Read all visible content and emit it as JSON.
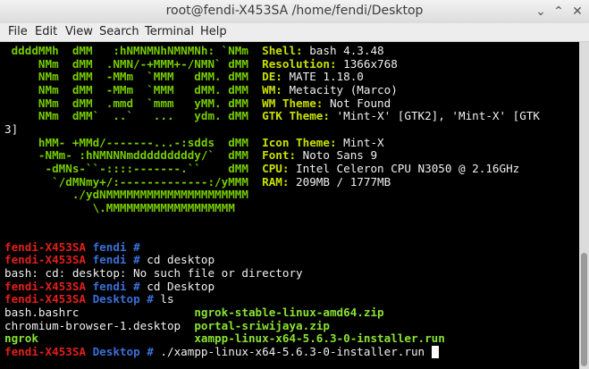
{
  "window": {
    "title": "root@fendi-X453SA /home/fendi/Desktop",
    "minimize_glyph": "⌄",
    "maximize_glyph": "⌃",
    "close_glyph": "✕"
  },
  "menu": [
    "File",
    "Edit",
    "View",
    "Search",
    "Terminal",
    "Help"
  ],
  "colors": {
    "ascii_green": "#77cc00",
    "info_key": "#c8e000",
    "text": "#f0f0f0",
    "prompt_red": "#e0201a",
    "prompt_blue": "#3a6fd8",
    "exec_green": "#8ae234"
  },
  "terminal": {
    "lines": [
      [
        {
          "t": " ddddMMh  dMM   :hNMNMNhNMNMNh: `NMm  ",
          "c": "ascii_green"
        },
        {
          "t": "Shell:",
          "c": "info_key"
        },
        {
          "t": " bash 4.3.48",
          "c": "text"
        }
      ],
      [
        {
          "t": "     NMm  dMM  .NMN/-+MMM+-/NMN` dMM  ",
          "c": "ascii_green"
        },
        {
          "t": "Resolution:",
          "c": "info_key"
        },
        {
          "t": " 1366x768",
          "c": "text"
        }
      ],
      [
        {
          "t": "     NMm  dMM  -MMm  `MMM   dMM. dMM  ",
          "c": "ascii_green"
        },
        {
          "t": "DE:",
          "c": "info_key"
        },
        {
          "t": " MATE 1.18.0",
          "c": "text"
        }
      ],
      [
        {
          "t": "     NMm  dMM  -MMm  `MMM   dMM. dMM  ",
          "c": "ascii_green"
        },
        {
          "t": "WM:",
          "c": "info_key"
        },
        {
          "t": " Metacity (Marco)",
          "c": "text"
        }
      ],
      [
        {
          "t": "     NMm  dMM  .mmd  `mmm   yMM. dMM  ",
          "c": "ascii_green"
        },
        {
          "t": "WM Theme:",
          "c": "info_key"
        },
        {
          "t": " Not Found",
          "c": "text"
        }
      ],
      [
        {
          "t": "     NMm  dMM`  ..`   ...   ydm. dMM  ",
          "c": "ascii_green"
        },
        {
          "t": "GTK Theme:",
          "c": "info_key"
        },
        {
          "t": " 'Mint-X' [GTK2], 'Mint-X' [GTK",
          "c": "text"
        }
      ],
      [
        {
          "t": "3]",
          "c": "text"
        }
      ],
      [
        {
          "t": "     hMM- +MMd/-------...-:sdds  dMM  ",
          "c": "ascii_green"
        },
        {
          "t": "Icon Theme:",
          "c": "info_key"
        },
        {
          "t": " Mint-X",
          "c": "text"
        }
      ],
      [
        {
          "t": "     -NMm- :hNMNNNmdddddddddy/`  dMM  ",
          "c": "ascii_green"
        },
        {
          "t": "Font:",
          "c": "info_key"
        },
        {
          "t": " Noto Sans 9",
          "c": "text"
        }
      ],
      [
        {
          "t": "      -dMNs-``-::::-------.``    dMM  ",
          "c": "ascii_green"
        },
        {
          "t": "CPU:",
          "c": "info_key"
        },
        {
          "t": " Intel Celeron CPU N3050 @ 2.16GHz",
          "c": "text"
        }
      ],
      [
        {
          "t": "       `/dMNmy+/:-------------:/yMMM  ",
          "c": "ascii_green"
        },
        {
          "t": "RAM:",
          "c": "info_key"
        },
        {
          "t": " 209MB / 1777MB",
          "c": "text"
        }
      ],
      [
        {
          "t": "          ./ydNMMMMMMMMMMMMMMMMMMMMM",
          "c": "ascii_green"
        }
      ],
      [
        {
          "t": "             \\.MMMMMMMMMMMMMMMMMMM",
          "c": "ascii_green"
        }
      ],
      [],
      [],
      [
        {
          "t": "fendi-X453SA",
          "c": "prompt_red"
        },
        {
          "t": " fendi #",
          "c": "prompt_blue"
        }
      ],
      [
        {
          "t": "fendi-X453SA",
          "c": "prompt_red"
        },
        {
          "t": " fendi #",
          "c": "prompt_blue"
        },
        {
          "t": " cd desktop",
          "c": "text"
        }
      ],
      [
        {
          "t": "bash: cd: desktop: No such file or directory",
          "c": "text"
        }
      ],
      [
        {
          "t": "fendi-X453SA",
          "c": "prompt_red"
        },
        {
          "t": " fendi #",
          "c": "prompt_blue"
        },
        {
          "t": " cd Desktop",
          "c": "text"
        }
      ],
      [
        {
          "t": "fendi-X453SA",
          "c": "prompt_red"
        },
        {
          "t": " Desktop #",
          "c": "prompt_blue"
        },
        {
          "t": " ls",
          "c": "text"
        }
      ],
      [
        {
          "t": "bash.bashrc                 ",
          "c": "text"
        },
        {
          "t": "ngrok-stable-linux-amd64.zip",
          "c": "exec_green"
        }
      ],
      [
        {
          "t": "chromium-browser-1.desktop  ",
          "c": "text"
        },
        {
          "t": "portal-sriwijaya.zip",
          "c": "exec_green"
        }
      ],
      [
        {
          "t": "ngrok",
          "c": "exec_green"
        },
        {
          "t": "                       ",
          "c": "text"
        },
        {
          "t": "xampp-linux-x64-5.6.3-0-installer.run",
          "c": "exec_green"
        }
      ],
      [
        {
          "t": "fendi-X453SA",
          "c": "prompt_red"
        },
        {
          "t": " Desktop #",
          "c": "prompt_blue"
        },
        {
          "t": " ./xampp-linux-x64-5.6.3-0-installer.run ",
          "c": "text"
        }
      ]
    ]
  }
}
